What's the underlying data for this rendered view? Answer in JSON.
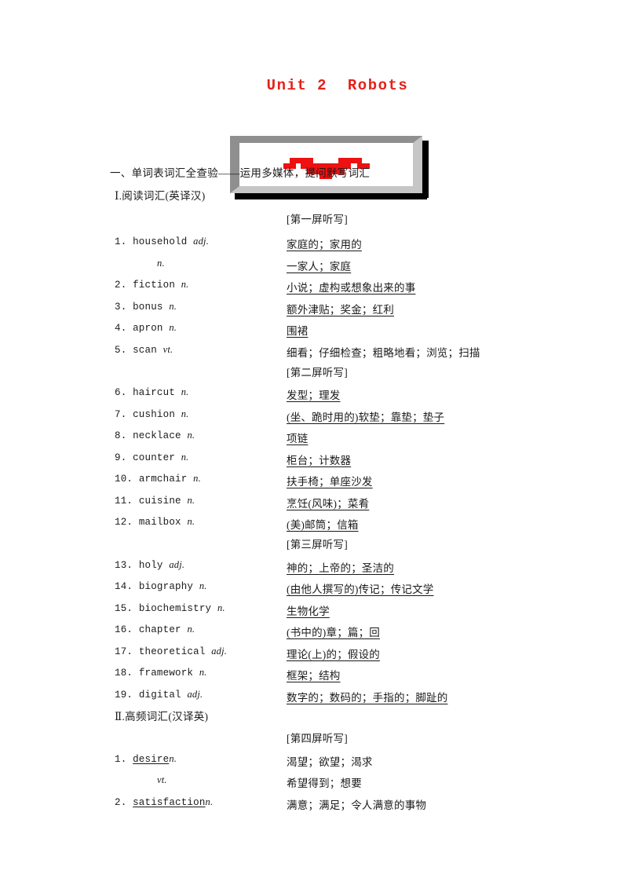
{
  "document": {
    "title": "Unit 2  Robots",
    "title_color": "#e3211a"
  },
  "media": {
    "caption_overlap": "",
    "art_color": "#ee1111",
    "art_name": "red-abstract-shape"
  },
  "headings": {
    "main": "一、单词表词汇全查验——运用多媒体，提问默写词汇",
    "section_1": "Ⅰ.阅读词汇(英译汉)",
    "section_2": "Ⅱ.高频词汇(汉译英)"
  },
  "screen_labels": {
    "screen_1": "[第一屏听写]",
    "screen_2": "[第二屏听写]",
    "screen_3": "[第三屏听写]",
    "screen_4": "[第四屏听写]"
  },
  "section_1_entries": [
    {
      "num": "1.",
      "word": "household",
      "pos": "adj.",
      "meaning": "家庭的；家用的",
      "underlined": true,
      "indent": false,
      "word_underlined": false
    },
    {
      "num": "",
      "word": "",
      "pos": "n.",
      "meaning": "一家人；家庭",
      "underlined": true,
      "indent": true,
      "word_underlined": false
    },
    {
      "num": "2.",
      "word": "fiction",
      "pos": "n.",
      "meaning": "小说；虚构或想象出来的事",
      "underlined": true,
      "indent": false,
      "word_underlined": false
    },
    {
      "num": "3.",
      "word": "bonus",
      "pos": "n.",
      "meaning": "额外津贴；奖金；红利",
      "underlined": true,
      "indent": false,
      "word_underlined": false
    },
    {
      "num": "4.",
      "word": "apron",
      "pos": "n.",
      "meaning": "围裙",
      "underlined": true,
      "indent": false,
      "word_underlined": false
    },
    {
      "num": "5.",
      "word": "scan",
      "pos": "vt.",
      "meaning": "细看；仔细检查；粗略地看；浏览；扫描",
      "underlined": false,
      "indent": false,
      "word_underlined": false
    },
    {
      "num": "6.",
      "word": "haircut",
      "pos": "n.",
      "meaning": "发型；理发",
      "underlined": true,
      "indent": false,
      "word_underlined": false
    },
    {
      "num": "7.",
      "word": "cushion",
      "pos": "n.",
      "meaning": "(坐、跪时用的)软垫；靠垫；垫子",
      "underlined": true,
      "indent": false,
      "word_underlined": false
    },
    {
      "num": "8.",
      "word": "necklace",
      "pos": "n.",
      "meaning": "项链",
      "underlined": true,
      "indent": false,
      "word_underlined": false
    },
    {
      "num": "9.",
      "word": "counter",
      "pos": "n.",
      "meaning": "柜台；计数器",
      "underlined": true,
      "indent": false,
      "word_underlined": false
    },
    {
      "num": "10.",
      "word": "armchair",
      "pos": "n.",
      "meaning": "扶手椅；单座沙发",
      "underlined": true,
      "indent": false,
      "word_underlined": false
    },
    {
      "num": "11.",
      "word": "cuisine",
      "pos": "n.",
      "meaning": "烹饪(风味)；菜肴",
      "underlined": true,
      "indent": false,
      "word_underlined": false
    },
    {
      "num": "12.",
      "word": "mailbox",
      "pos": "n.",
      "meaning": "(美)邮筒；信箱",
      "underlined": true,
      "indent": false,
      "word_underlined": false
    },
    {
      "num": "13.",
      "word": "holy",
      "pos": "adj.",
      "meaning": "神的；上帝的；圣洁的",
      "underlined": true,
      "indent": false,
      "word_underlined": false
    },
    {
      "num": "14.",
      "word": "biography",
      "pos": "n.",
      "meaning": "(由他人撰写的)传记；传记文学",
      "underlined": true,
      "indent": false,
      "word_underlined": false
    },
    {
      "num": "15.",
      "word": "biochemistry",
      "pos": "n.",
      "meaning": "生物化学",
      "underlined": true,
      "indent": false,
      "word_underlined": false
    },
    {
      "num": "16.",
      "word": "chapter",
      "pos": "n.",
      "meaning": "(书中的)章；篇；回",
      "underlined": true,
      "indent": false,
      "word_underlined": false
    },
    {
      "num": "17.",
      "word": "theoretical",
      "pos": "adj.",
      "meaning": "理论(上)的；假设的",
      "underlined": true,
      "indent": false,
      "word_underlined": false
    },
    {
      "num": "18.",
      "word": "framework",
      "pos": "n.",
      "meaning": "框架；结构",
      "underlined": true,
      "indent": false,
      "word_underlined": false
    },
    {
      "num": "19.",
      "word": "digital",
      "pos": "adj.",
      "meaning": "数字的；数码的；手指的；脚趾的",
      "underlined": true,
      "indent": false,
      "word_underlined": false
    }
  ],
  "section_2_entries": [
    {
      "num": "1.",
      "word": "desire",
      "pos": "n.",
      "meaning": "渴望；欲望；渴求",
      "underlined": false,
      "indent": false,
      "word_underlined": true
    },
    {
      "num": "",
      "word": "",
      "pos": "vt.",
      "meaning": "希望得到；想要",
      "underlined": false,
      "indent": true,
      "word_underlined": false
    },
    {
      "num": "2.",
      "word": "satisfaction",
      "pos": "n.",
      "meaning": "满意；满足；令人满意的事物",
      "underlined": false,
      "indent": false,
      "word_underlined": true
    }
  ]
}
